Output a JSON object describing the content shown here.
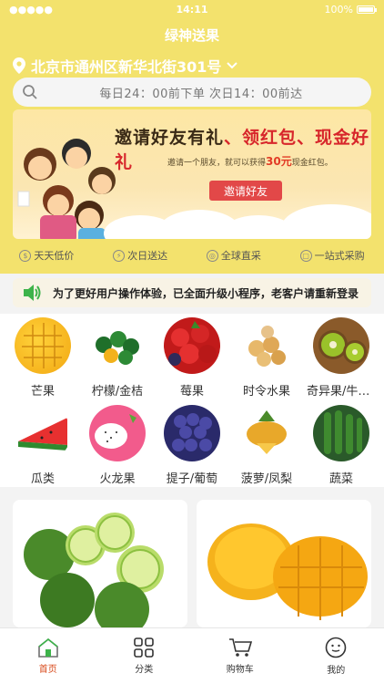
{
  "status": {
    "carrier_dots": "●●●●●",
    "time": "14:11",
    "battery": "100%"
  },
  "app": {
    "title": "绿神送果"
  },
  "location": {
    "address": "北京市通州区新华北街301号"
  },
  "search": {
    "text": "每日24：00前下单  次日14：00前达"
  },
  "banner": {
    "title_red_1": "邀请好友有礼",
    "title_red_2": "领红包、现金好礼",
    "subtitle_pre": "邀请一个朋友，就可以获得",
    "subtitle_highlight": "30元",
    "subtitle_post": "现金红包。",
    "button": "邀请好友"
  },
  "features": [
    {
      "icon": "tag-icon",
      "label": "天天低价"
    },
    {
      "icon": "lightning-icon",
      "label": "次日送达"
    },
    {
      "icon": "globe-icon",
      "label": "全球直采"
    },
    {
      "icon": "box-icon",
      "label": "一站式采购"
    }
  ],
  "notice": {
    "text": "为了更好用户操作体验，已全面升级小程序，老客户请重新登录"
  },
  "categories": [
    {
      "label": "芒果",
      "icon": "mango-icon"
    },
    {
      "label": "柠檬/金桔",
      "icon": "lemon-icon"
    },
    {
      "label": "莓果",
      "icon": "berry-icon"
    },
    {
      "label": "时令水果",
      "icon": "seasonal-fruit-icon"
    },
    {
      "label": "奇异果/牛油果",
      "icon": "kiwi-icon"
    },
    {
      "label": "瓜类",
      "icon": "melon-icon"
    },
    {
      "label": "火龙果",
      "icon": "dragonfruit-icon"
    },
    {
      "label": "提子/葡萄",
      "icon": "grape-icon"
    },
    {
      "label": "菠萝/凤梨",
      "icon": "pineapple-icon"
    },
    {
      "label": "蔬菜",
      "icon": "vegetable-icon"
    }
  ],
  "tabbar": [
    {
      "label": "首页",
      "icon": "home-icon",
      "active": true
    },
    {
      "label": "分类",
      "icon": "grid-icon",
      "active": false
    },
    {
      "label": "购物车",
      "icon": "cart-icon",
      "active": false
    },
    {
      "label": "我的",
      "icon": "face-icon",
      "active": false
    }
  ],
  "colors": {
    "theme": "#f3e26d",
    "accent": "#d84a1b",
    "banner_button": "#e24848"
  }
}
